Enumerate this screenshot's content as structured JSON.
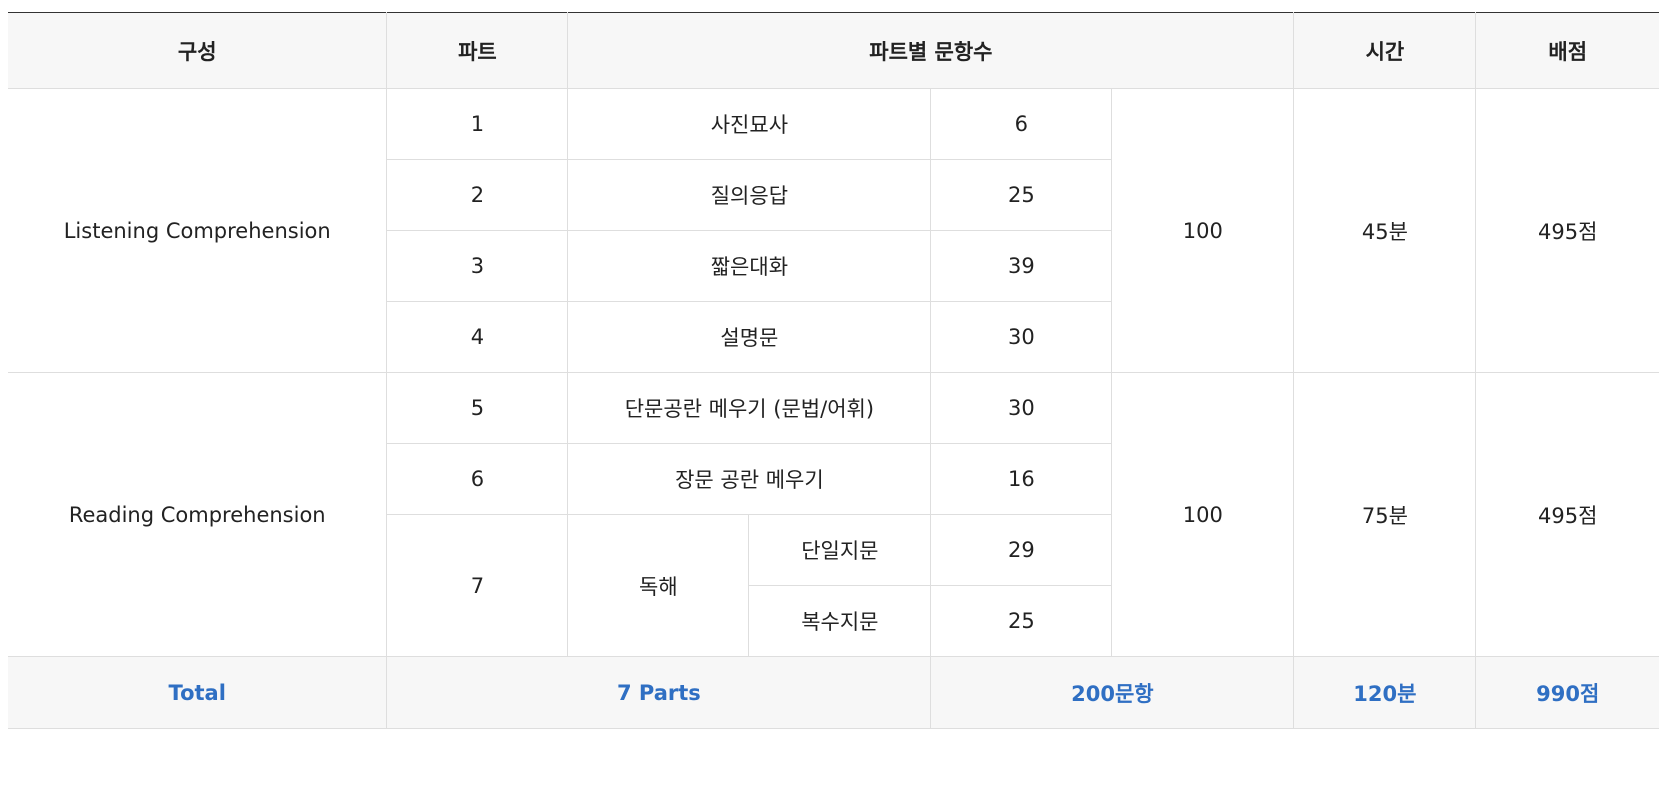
{
  "header": {
    "composition": "구성",
    "part": "파트",
    "questions_per_part": "파트별 문항수",
    "time": "시간",
    "score": "배점"
  },
  "sections": [
    {
      "name": "Listening Comprehension",
      "total_questions": "100",
      "time": "45분",
      "score": "495점",
      "parts": [
        {
          "num": "1",
          "type": "사진묘사",
          "count": "6"
        },
        {
          "num": "2",
          "type": "질의응답",
          "count": "25"
        },
        {
          "num": "3",
          "type": "짧은대화",
          "count": "39"
        },
        {
          "num": "4",
          "type": "설명문",
          "count": "30"
        }
      ]
    },
    {
      "name": "Reading Comprehension",
      "total_questions": "100",
      "time": "75분",
      "score": "495점",
      "parts": [
        {
          "num": "5",
          "type": "단문공란 메우기 (문법/어휘)",
          "count": "30"
        },
        {
          "num": "6",
          "type": "장문 공란 메우기",
          "count": "16"
        },
        {
          "num": "7",
          "type": "독해",
          "subparts": [
            {
              "type": "단일지문",
              "count": "29"
            },
            {
              "type": "복수지문",
              "count": "25"
            }
          ]
        }
      ]
    }
  ],
  "total": {
    "label": "Total",
    "parts": "7 Parts",
    "questions": "200문항",
    "time": "120분",
    "score": "990점"
  },
  "colors": {
    "accent_total": "#2f6fc3",
    "header_bg": "#f7f7f7",
    "border": "#dedede"
  }
}
